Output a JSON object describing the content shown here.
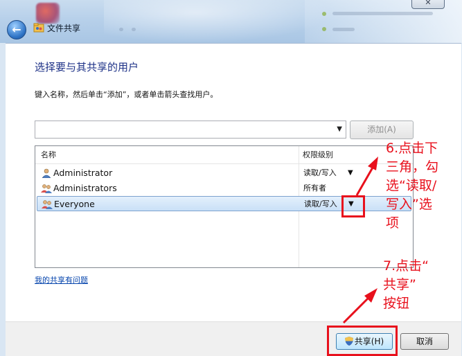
{
  "window": {
    "title": "文件共享",
    "close_glyph": "✕",
    "back_glyph": "←"
  },
  "dialog": {
    "heading": "选择要与其共享的用户",
    "instruction": "键入名称，然后单击“添加”，或者单击箭头查找用户。",
    "name_input": {
      "value": "",
      "placeholder": ""
    },
    "add_button": "添加(A)",
    "table": {
      "columns": [
        "名称",
        "权限级别"
      ],
      "rows": [
        {
          "name": "Administrator",
          "permission": "读取/写入",
          "has_dropdown": true,
          "icon": "user-icon",
          "selected": false
        },
        {
          "name": "Administrators",
          "permission": "所有者",
          "has_dropdown": false,
          "icon": "group-icon",
          "selected": false
        },
        {
          "name": "Everyone",
          "permission": "读取/写入",
          "has_dropdown": true,
          "icon": "group-icon",
          "selected": true
        }
      ]
    },
    "help_link": "我的共享有问题",
    "share_button": "共享(H)",
    "cancel_button": "取消"
  },
  "annotations": {
    "step6": [
      "6.点击下",
      "三角，勾",
      "选“读取/",
      "写入”选",
      "项"
    ],
    "step7": [
      "7.点击“",
      "共享”",
      "按钮"
    ],
    "color": "#e8101c"
  },
  "colors": {
    "heading": "#1e3287",
    "link": "#0645ad",
    "selection": "#c9e0f7"
  }
}
